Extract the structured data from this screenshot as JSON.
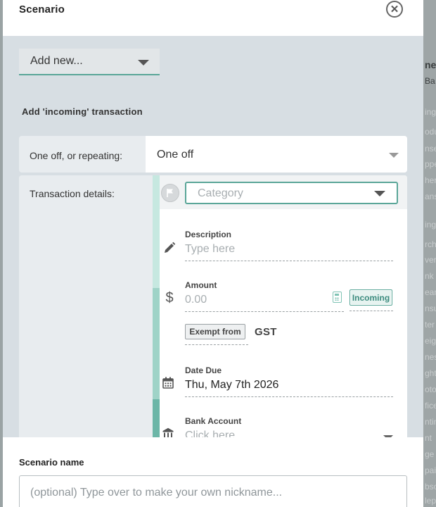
{
  "modal": {
    "title": "Scenario",
    "close_glyph": "✕"
  },
  "add_new": {
    "label": "Add new..."
  },
  "section": {
    "title": "Add 'incoming' transaction"
  },
  "repeat": {
    "label": "One off, or repeating:",
    "value": "One off"
  },
  "details": {
    "label": "Transaction details:",
    "category": {
      "placeholder": "Category"
    },
    "description": {
      "label": "Description",
      "placeholder": "Type here"
    },
    "amount": {
      "label": "Amount",
      "placeholder": "0.00",
      "direction": "Incoming"
    },
    "tax": {
      "exempt_label": "Exempt from",
      "tax_name": "GST"
    },
    "date_due": {
      "label": "Date Due",
      "value": "Thu, May 7th 2026"
    },
    "bank_account": {
      "label": "Bank Account",
      "placeholder": "Click here"
    }
  },
  "footer": {
    "title": "Scenario name",
    "name_placeholder": "(optional) Type over to make your own nickname..."
  },
  "colors": {
    "accent": "#5aa698",
    "accent_light": "#a8d8ce",
    "panel_bg": "#d7dee3"
  },
  "icons": {
    "flag": "flag-icon",
    "pencil": "pencil-icon",
    "dollar": "dollar-icon",
    "calculator": "calculator-icon",
    "calendar": "calendar-icon",
    "bank": "bank-icon"
  },
  "background_page": {
    "visible_fragments": [
      "ne",
      "Ba",
      "ing",
      "odu",
      "nse",
      "ppe",
      "her",
      "ans",
      "ing",
      "rch",
      "ver",
      "nk",
      "ean",
      "nsu",
      "ter",
      "eigh",
      "nes",
      "ght,",
      "oto",
      "fice",
      "ntin",
      "nt",
      "ge",
      "pai",
      "bsc",
      "lep"
    ]
  }
}
